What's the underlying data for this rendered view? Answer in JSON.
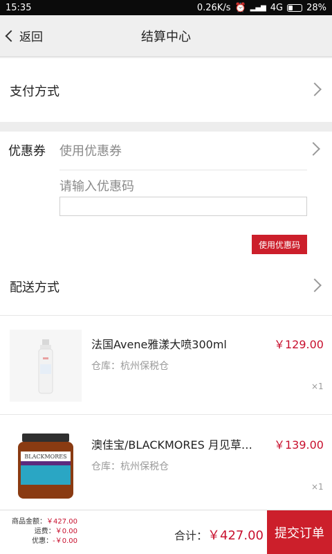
{
  "status": {
    "time": "15:35",
    "speed": "0.26K/s",
    "network": "4G",
    "battery": "28%"
  },
  "nav": {
    "back_label": "返回",
    "title": "结算中心"
  },
  "payment": {
    "label": "支付方式"
  },
  "coupon": {
    "label": "优惠券",
    "value": "使用优惠券",
    "code_label": "请输入优惠码",
    "code_placeholder": "",
    "apply_button": "使用优惠码"
  },
  "shipping": {
    "label": "配送方式"
  },
  "products": [
    {
      "name": "法国Avene雅漾大喷300ml",
      "price": "￥129.00",
      "warehouse": "仓库：杭州保税仓",
      "qty": "×1"
    },
    {
      "name": "澳佳宝/BLACKMORES 月见草…",
      "price": "￥139.00",
      "warehouse": "仓库：杭州保税仓",
      "qty": "×1",
      "brand_text": "BLACKMORES"
    }
  ],
  "summary": {
    "goods_label": "商品金额：",
    "goods_value": "￥427.00",
    "freight_label": "运费：",
    "freight_value": "￥0.00",
    "discount_label": "优惠：",
    "discount_value": "-￥0.00",
    "total_label": "合计：",
    "total_value": "￥427.00",
    "submit_label": "提交订单"
  },
  "colors": {
    "accent": "#cc1f2b",
    "price": "#c8102e"
  }
}
